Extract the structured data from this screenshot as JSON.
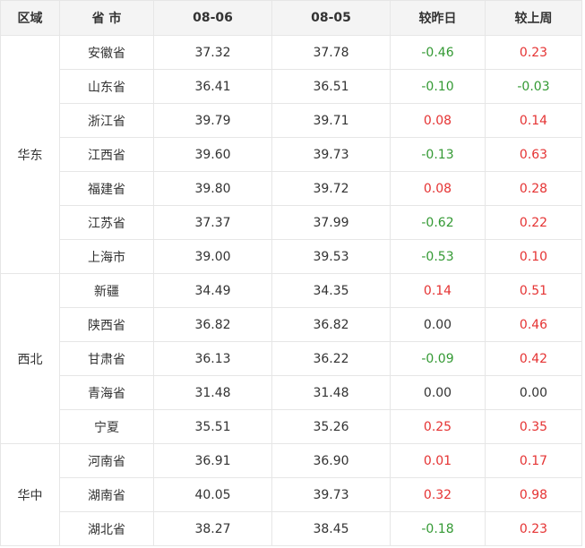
{
  "headers": [
    "区域",
    "省 市",
    "08-06",
    "08-05",
    "较昨日",
    "较上周"
  ],
  "colors": {
    "up": "#e53333",
    "down": "#339933",
    "flat": "#333333",
    "header_bg": "#f4f4f4",
    "border": "#e6e6e6"
  },
  "groups": [
    {
      "region": "华东",
      "rows": [
        {
          "province": "安徽省",
          "d0806": "37.32",
          "d0805": "37.78",
          "vs_yesterday": "-0.46",
          "vs_last_week": "0.23"
        },
        {
          "province": "山东省",
          "d0806": "36.41",
          "d0805": "36.51",
          "vs_yesterday": "-0.10",
          "vs_last_week": "-0.03"
        },
        {
          "province": "浙江省",
          "d0806": "39.79",
          "d0805": "39.71",
          "vs_yesterday": "0.08",
          "vs_last_week": "0.14"
        },
        {
          "province": "江西省",
          "d0806": "39.60",
          "d0805": "39.73",
          "vs_yesterday": "-0.13",
          "vs_last_week": "0.63"
        },
        {
          "province": "福建省",
          "d0806": "39.80",
          "d0805": "39.72",
          "vs_yesterday": "0.08",
          "vs_last_week": "0.28"
        },
        {
          "province": "江苏省",
          "d0806": "37.37",
          "d0805": "37.99",
          "vs_yesterday": "-0.62",
          "vs_last_week": "0.22"
        },
        {
          "province": "上海市",
          "d0806": "39.00",
          "d0805": "39.53",
          "vs_yesterday": "-0.53",
          "vs_last_week": "0.10"
        }
      ]
    },
    {
      "region": "西北",
      "rows": [
        {
          "province": "新疆",
          "d0806": "34.49",
          "d0805": "34.35",
          "vs_yesterday": "0.14",
          "vs_last_week": "0.51"
        },
        {
          "province": "陕西省",
          "d0806": "36.82",
          "d0805": "36.82",
          "vs_yesterday": "0.00",
          "vs_last_week": "0.46"
        },
        {
          "province": "甘肃省",
          "d0806": "36.13",
          "d0805": "36.22",
          "vs_yesterday": "-0.09",
          "vs_last_week": "0.42"
        },
        {
          "province": "青海省",
          "d0806": "31.48",
          "d0805": "31.48",
          "vs_yesterday": "0.00",
          "vs_last_week": "0.00"
        },
        {
          "province": "宁夏",
          "d0806": "35.51",
          "d0805": "35.26",
          "vs_yesterday": "0.25",
          "vs_last_week": "0.35"
        }
      ]
    },
    {
      "region": "华中",
      "rows": [
        {
          "province": "河南省",
          "d0806": "36.91",
          "d0805": "36.90",
          "vs_yesterday": "0.01",
          "vs_last_week": "0.17"
        },
        {
          "province": "湖南省",
          "d0806": "40.05",
          "d0805": "39.73",
          "vs_yesterday": "0.32",
          "vs_last_week": "0.98"
        },
        {
          "province": "湖北省",
          "d0806": "38.27",
          "d0805": "38.45",
          "vs_yesterday": "-0.18",
          "vs_last_week": "0.23"
        }
      ]
    }
  ]
}
